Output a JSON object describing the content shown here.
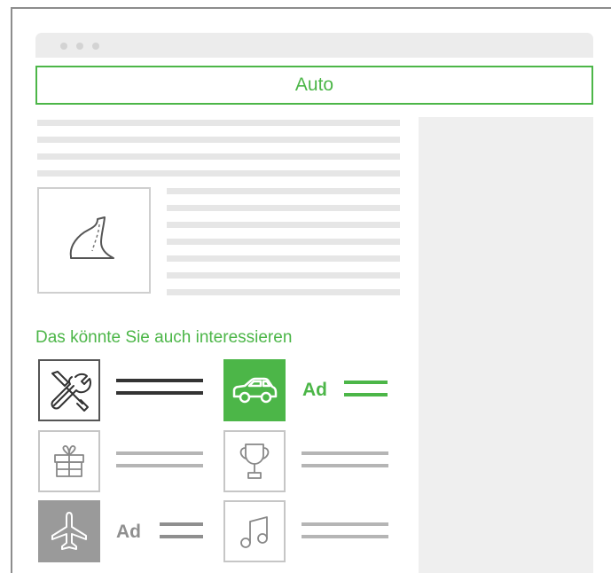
{
  "category_bar": {
    "label": "Auto"
  },
  "recommendations": {
    "heading": "Das könnte Sie auch interessieren",
    "ad_label": "Ad"
  },
  "icons": [
    "tools-icon",
    "car-icon",
    "gift-icon",
    "trophy-icon",
    "airplane-icon",
    "music-note-icon",
    "road-icon"
  ],
  "colors": {
    "accent": "#4cb648",
    "frame": "#8d8d8d",
    "sidebar": "#efefef",
    "placeholder_line": "#e6e6e6",
    "tile_gray": "#9a9a9a"
  }
}
